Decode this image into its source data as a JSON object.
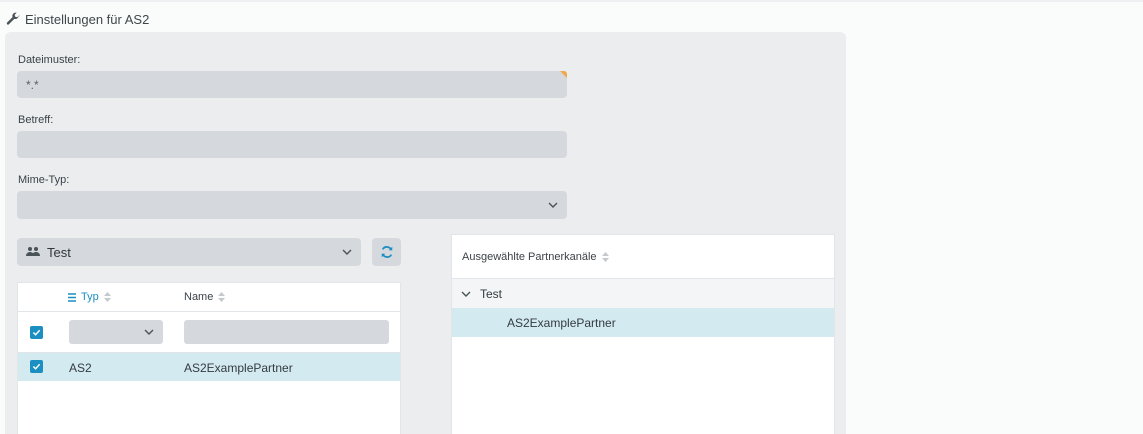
{
  "header": {
    "title": "Einstellungen für AS2",
    "icon": "wrench-icon"
  },
  "form": {
    "file_pattern": {
      "label": "Dateimuster:",
      "value": "*.*"
    },
    "subject": {
      "label": "Betreff:",
      "value": ""
    },
    "mime_type": {
      "label": "Mime-Typ:",
      "value": ""
    }
  },
  "partner_group": {
    "selected": "Test",
    "icon": "user-group-icon"
  },
  "left_table": {
    "columns": [
      {
        "label": "Typ"
      },
      {
        "label": "Name"
      }
    ],
    "rows": [
      {
        "type": "AS2",
        "name": "AS2ExamplePartner",
        "checked": true
      }
    ]
  },
  "right_table": {
    "header": "Ausgewählte Partnerkanäle",
    "group": "Test",
    "items": [
      "AS2ExamplePartner"
    ]
  },
  "colors": {
    "accent": "#1b8fc1",
    "selected_row": "#d4eaf1",
    "field_bg": "#d5d9dd",
    "required_marker": "#f0a94a"
  }
}
